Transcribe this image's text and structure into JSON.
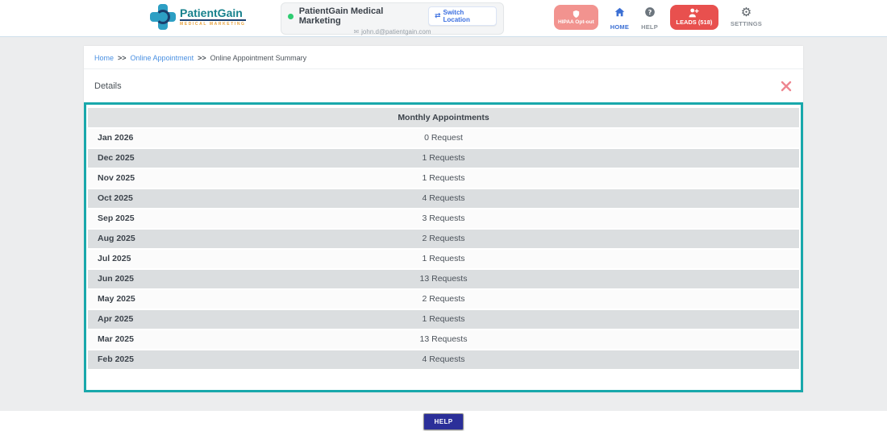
{
  "header": {
    "brand": {
      "name": "PatientGain",
      "tagline": "MEDICAL MARKETING"
    },
    "account": {
      "name": "PatientGain Medical Marketing",
      "switch_location_label": "Switch Location",
      "email": "john.d@patientgain.com",
      "status_color": "#2ecc71"
    },
    "nav": [
      {
        "label": "HIPAA Opt-out",
        "icon": "shield-icon",
        "color": "#f2938f"
      },
      {
        "label": "HOME",
        "icon": "home-icon",
        "active": true
      },
      {
        "label": "HELP",
        "icon": "question-icon"
      },
      {
        "label": "LEADS (518)",
        "icon": "person-plus-icon",
        "color": "#e8504e"
      },
      {
        "label": "SETTINGS",
        "icon": "gear-icon"
      }
    ]
  },
  "breadcrumb": {
    "separator": ">>",
    "items": [
      {
        "label": "Home"
      },
      {
        "label": "Online Appointment"
      },
      {
        "label": "Online Appointment Summary"
      }
    ]
  },
  "panel": {
    "title": "Details",
    "close_icon": "close-icon"
  },
  "table": {
    "header": "Monthly Appointments",
    "rows": [
      {
        "month": "Jan 2026",
        "value": "0 Request"
      },
      {
        "month": "Dec 2025",
        "value": "1 Requests"
      },
      {
        "month": "Nov 2025",
        "value": "1 Requests"
      },
      {
        "month": "Oct 2025",
        "value": "4 Requests"
      },
      {
        "month": "Sep 2025",
        "value": "3 Requests"
      },
      {
        "month": "Aug 2025",
        "value": "2 Requests"
      },
      {
        "month": "Jul 2025",
        "value": "1 Requests"
      },
      {
        "month": "Jun 2025",
        "value": "13 Requests"
      },
      {
        "month": "May 2025",
        "value": "2 Requests"
      },
      {
        "month": "Apr 2025",
        "value": "1 Requests"
      },
      {
        "month": "Mar 2025",
        "value": "13 Requests"
      },
      {
        "month": "Feb 2025",
        "value": "4 Requests"
      }
    ]
  },
  "footer": {
    "help_label": "HELP"
  },
  "colors": {
    "accent_teal": "#18a8ab",
    "leads_red": "#e8504e",
    "hipaa_salmon": "#f2938f",
    "help_navy": "#2b2f99",
    "link_blue": "#4a90e2",
    "close_pink": "#ee8690",
    "brand_teal": "#17818c",
    "brand_orange": "#e8a33d"
  }
}
